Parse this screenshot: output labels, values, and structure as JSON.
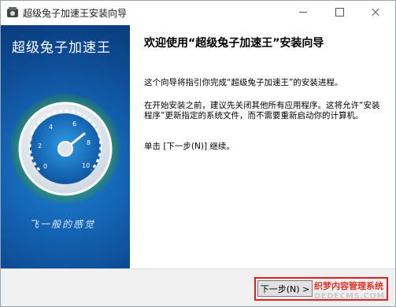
{
  "window": {
    "title": "超级兔子加速王安装向导"
  },
  "banner": {
    "title": "超级兔子加速王",
    "slogan": "飞一般的感觉",
    "gauge_ticks": [
      "0",
      "2",
      "4",
      "6",
      "8",
      "10"
    ]
  },
  "content": {
    "heading": "欢迎使用“超级兔子加速王”安装向导",
    "paragraph1": "这个向导将指引你完成“超级兔子加速王”的安装进程。",
    "paragraph2": "在开始安装之前，建议先关闭其他所有应用程序。这将允许“安装程序”更新指定的系统文件，而不需要重新启动你的计算机。",
    "paragraph3": "单击 [下一步(N)] 继续。"
  },
  "footer": {
    "next_label": "下一步(N) >",
    "watermark_top": "织梦内容管理系统",
    "watermark_bottom": "DEDECMS.COM"
  },
  "colors": {
    "banner_blue": "#1566b6",
    "highlight_red": "#e02020",
    "gauge_green": "#6cc13a"
  }
}
